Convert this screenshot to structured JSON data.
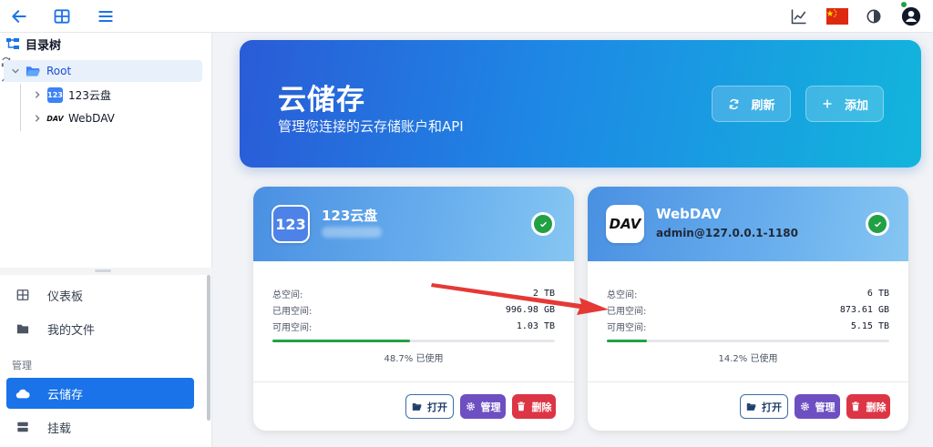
{
  "topbar": {
    "icons": [
      "back-arrow-icon",
      "grid-icon",
      "menu-icon",
      "chart-icon",
      "china-flag-icon",
      "contrast-icon",
      "user-account-icon"
    ]
  },
  "tree": {
    "title": "目录树",
    "root_label": "Root",
    "items": [
      {
        "label": "123云盘",
        "icon": "123pan-logo-icon"
      },
      {
        "label": "WebDAV",
        "icon": "webdav-logo-icon"
      }
    ]
  },
  "nav": {
    "items": [
      {
        "label": "仪表板"
      },
      {
        "label": "我的文件"
      }
    ],
    "group_label": "管理",
    "active_label": "云储存",
    "mount_label": "挂载"
  },
  "hero": {
    "title": "云储存",
    "subtitle": "管理您连接的云存储账户和API",
    "refresh_label": "刷新",
    "add_label": "添加"
  },
  "labels": {
    "total": "总空间:",
    "used": "已用空间:",
    "available": "可用空间:",
    "open": "打开",
    "manage": "管理",
    "delete": "删除"
  },
  "cards": [
    {
      "name": "123云盘",
      "subtitle": "",
      "logo_text": "123",
      "total": "2 TB",
      "used": "996.98 GB",
      "available": "1.03 TB",
      "used_fraction": 0.487,
      "used_text": "48.7% 已使用"
    },
    {
      "name": "WebDAV",
      "subtitle": "admin@127.0.0.1-1180",
      "logo_text": "DAV",
      "total": "6 TB",
      "used": "873.61 GB",
      "available": "5.15 TB",
      "used_fraction": 0.142,
      "used_text": "14.2% 已使用"
    }
  ],
  "colors": {
    "accent": "#1a73e8",
    "success": "#22a045",
    "danger": "#dc3545",
    "manage": "#6d4fc2",
    "annotation_arrow": "#e53935"
  }
}
